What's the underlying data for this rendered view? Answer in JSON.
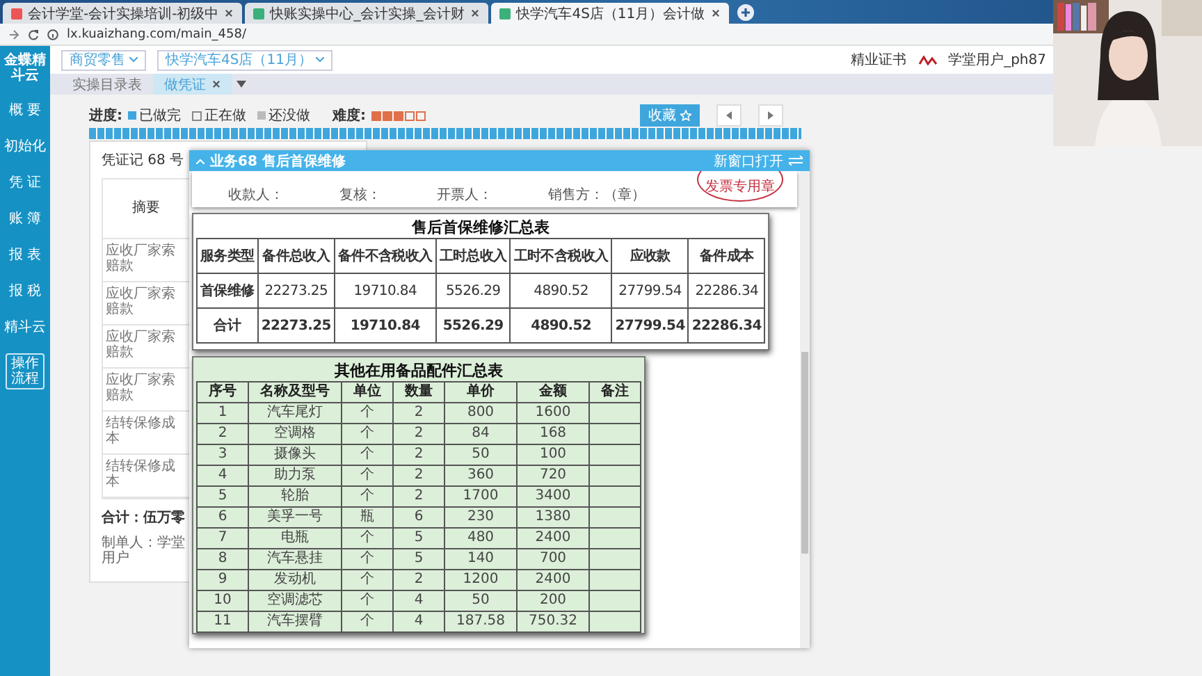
{
  "browser": {
    "tabs": [
      {
        "title": "会计学堂-会计实操培训-初级中",
        "selected": false
      },
      {
        "title": "快账实操中心_会计实操_会计财",
        "selected": false
      },
      {
        "title": "快学汽车4S店（11月）会计做",
        "selected": true
      }
    ],
    "url": "lx.kuaizhang.com/main_458/"
  },
  "sidebar": {
    "logo": "金蝶精斗云",
    "items": [
      {
        "label": "概 要"
      },
      {
        "label": "初始化"
      },
      {
        "label": "凭 证"
      },
      {
        "label": "账 簿"
      },
      {
        "label": "报 表"
      },
      {
        "label": "报 税"
      },
      {
        "label": "精斗云"
      }
    ],
    "guide_button": "操作流程"
  },
  "header": {
    "dropdowns": [
      "商贸零售",
      "快学汽车4S店（11月）"
    ],
    "certificate": "精业证书",
    "user": "学堂用户_ph87"
  },
  "page_tabs": [
    {
      "label": "实操目录表",
      "selected": false
    },
    {
      "label": "做凭证",
      "selected": true
    }
  ],
  "progress": {
    "label": "进度:",
    "legend": [
      {
        "label": "已做完",
        "kind": "done"
      },
      {
        "label": "正在做",
        "kind": "doing"
      },
      {
        "label": "还没做",
        "kind": "todo"
      }
    ],
    "difficulty_label": "难度:",
    "stars": 3
  },
  "collect_button": "收藏",
  "voucher": {
    "title": "凭证记 68 号",
    "column": "摘要",
    "rows": [
      "应收厂家索赔款",
      "应收厂家索赔款",
      "应收厂家索赔款",
      "应收厂家索赔款",
      "结转保修成本",
      "结转保修成本"
    ],
    "total": "合计：伍万零",
    "maker": "制单人：学堂用户"
  },
  "popup": {
    "title": "业务68 售后首保维修",
    "open_new": "新窗口打开",
    "invoice_strip": [
      "收款人：",
      "复核：",
      "开票人：",
      "销售方：（章）"
    ],
    "stamp": "发票专用章",
    "summary_table": {
      "title": "售后首保维修汇总表",
      "columns": [
        "服务类型",
        "备件总收入",
        "备件不含税收入",
        "工时总收入",
        "工时不含税收入",
        "应收款",
        "备件成本"
      ],
      "rows": [
        {
          "kind": "data",
          "cells": [
            "首保维修",
            "22273.25",
            "19710.84",
            "5526.29",
            "4890.52",
            "27799.54",
            "22286.34"
          ]
        },
        {
          "kind": "total",
          "cells": [
            "合计",
            "22273.25",
            "19710.84",
            "5526.29",
            "4890.52",
            "27799.54",
            "22286.34"
          ]
        }
      ]
    },
    "parts_table": {
      "title": "其他在用备品配件汇总表",
      "columns": [
        "序号",
        "名称及型号",
        "单位",
        "数量",
        "单价",
        "金额",
        "备注"
      ],
      "rows": [
        [
          "1",
          "汽车尾灯",
          "个",
          "2",
          "800",
          "1600"
        ],
        [
          "2",
          "空调格",
          "个",
          "2",
          "84",
          "168"
        ],
        [
          "3",
          "摄像头",
          "个",
          "2",
          "50",
          "100"
        ],
        [
          "4",
          "助力泵",
          "个",
          "2",
          "360",
          "720"
        ],
        [
          "5",
          "轮胎",
          "个",
          "2",
          "1700",
          "3400"
        ],
        [
          "6",
          "美孚一号",
          "瓶",
          "6",
          "230",
          "1380"
        ],
        [
          "7",
          "电瓶",
          "个",
          "5",
          "480",
          "2400"
        ],
        [
          "8",
          "汽车悬挂",
          "个",
          "5",
          "140",
          "700"
        ],
        [
          "9",
          "发动机",
          "个",
          "2",
          "1200",
          "2400"
        ],
        [
          "10",
          "空调滤芯",
          "个",
          "4",
          "50",
          "200"
        ],
        [
          "11",
          "汽车摆臂",
          "个",
          "4",
          "187.58",
          "750.32"
        ]
      ]
    }
  }
}
